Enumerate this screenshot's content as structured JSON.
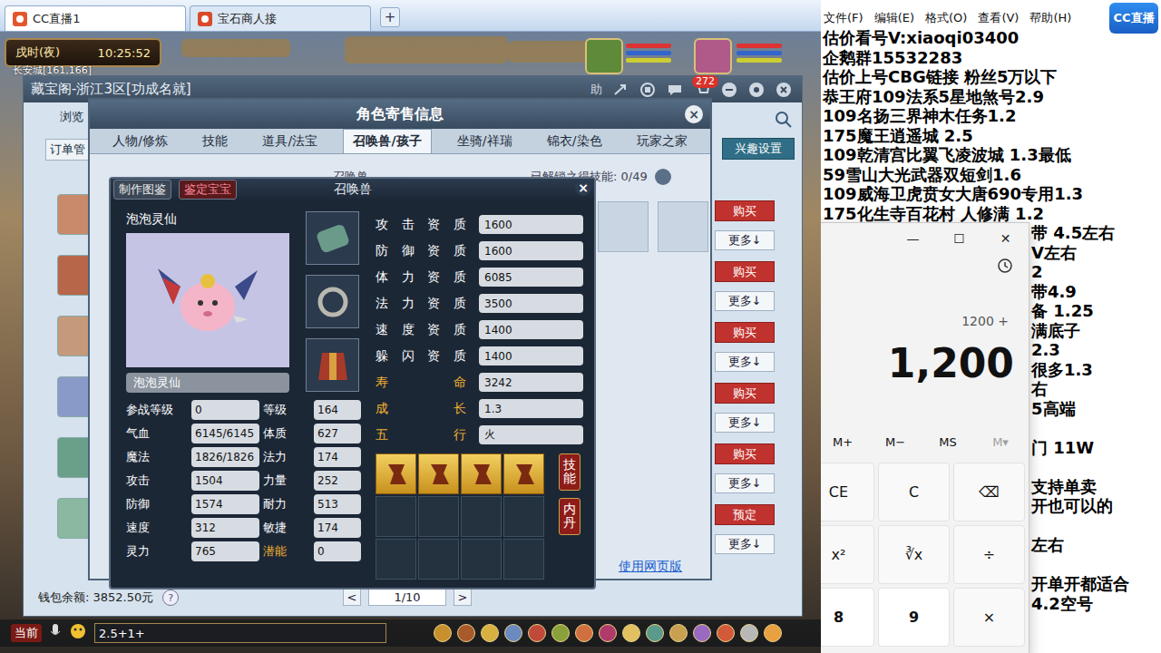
{
  "browser": {
    "tabs": [
      {
        "label": "CC直播1",
        "selected": true
      },
      {
        "label": "宝石商人接",
        "selected": false
      }
    ],
    "new_tab": "+"
  },
  "hud": {
    "period": "戌时(夜)",
    "clock": "10:25:52",
    "location": "长安城[161,166]"
  },
  "cbg": {
    "title": "藏宝阁-浙江3区[功成名就]",
    "help": "助",
    "badge": "272",
    "browse_tab": "浏览",
    "orders_button": "订单管",
    "interest_button": "兴趣设置",
    "rows": [
      {
        "action": "购买",
        "more": "更多↓"
      },
      {
        "action": "购买",
        "more": "更多↓"
      },
      {
        "action": "购买",
        "more": "更多↓"
      },
      {
        "action": "购买",
        "more": "更多↓"
      },
      {
        "action": "购买",
        "more": "更多↓"
      },
      {
        "action": "预定",
        "more": "更多↓"
      }
    ],
    "wallet": "钱包余额: 3852.50元",
    "wallet_help": "?",
    "prev": "<",
    "page": "1/10",
    "next": ">"
  },
  "sale": {
    "title": "角色寄售信息",
    "close": "×",
    "tabs": [
      {
        "label": "人物/修炼",
        "selected": false
      },
      {
        "label": "技能",
        "selected": false
      },
      {
        "label": "道具/法宝",
        "selected": false
      },
      {
        "label": "召唤兽/孩子",
        "selected": true
      },
      {
        "label": "坐骑/祥瑞",
        "selected": false
      },
      {
        "label": "锦衣/染色",
        "selected": false
      },
      {
        "label": "玩家之家",
        "selected": false
      }
    ],
    "section_label": "召唤兽",
    "unlocked": "已解锁之得技能: 0/49",
    "web_link": "使用网页版"
  },
  "pet": {
    "tool_buttons": [
      {
        "label": "制作图鉴"
      },
      {
        "label": "鉴定宝宝"
      }
    ],
    "title": "召唤兽",
    "close": "×",
    "name_label": "泡泡灵仙",
    "name_field": "泡泡灵仙",
    "stats": [
      {
        "left": {
          "label": "参战等级",
          "value": "0",
          "highlight": false
        },
        "right": {
          "label": "等级",
          "value": "164",
          "highlight": false
        }
      },
      {
        "left": {
          "label": "气血",
          "value": "6145/6145",
          "highlight": false
        },
        "right": {
          "label": "体质",
          "value": "627",
          "highlight": false
        }
      },
      {
        "left": {
          "label": "魔法",
          "value": "1826/1826",
          "highlight": false
        },
        "right": {
          "label": "法力",
          "value": "174",
          "highlight": false
        }
      },
      {
        "left": {
          "label": "攻击",
          "value": "1504",
          "highlight": false
        },
        "right": {
          "label": "力量",
          "value": "252",
          "highlight": false
        }
      },
      {
        "left": {
          "label": "防御",
          "value": "1574",
          "highlight": false
        },
        "right": {
          "label": "耐力",
          "value": "513",
          "highlight": false
        }
      },
      {
        "left": {
          "label": "速度",
          "value": "312",
          "highlight": false
        },
        "right": {
          "label": "敏捷",
          "value": "174",
          "highlight": false
        }
      },
      {
        "left": {
          "label": "灵力",
          "value": "765",
          "highlight": false
        },
        "right": {
          "label": "潜能",
          "value": "0",
          "highlight": true
        }
      }
    ],
    "qualities": [
      {
        "label": "攻击资质",
        "value": "1600",
        "highlight": false
      },
      {
        "label": "防御资质",
        "value": "1600",
        "highlight": false
      },
      {
        "label": "体力资质",
        "value": "6085",
        "highlight": false
      },
      {
        "label": "法力资质",
        "value": "3500",
        "highlight": false
      },
      {
        "label": "速度资质",
        "value": "1400",
        "highlight": false
      },
      {
        "label": "躲闪资质",
        "value": "1400",
        "highlight": false
      },
      {
        "label": "寿命",
        "value": "3242",
        "highlight": true
      },
      {
        "label": "成长",
        "value": "1.3",
        "highlight": true
      },
      {
        "label": "五行",
        "value": "火",
        "highlight": true
      }
    ],
    "skills": [
      {
        "filled": true
      },
      {
        "filled": true
      },
      {
        "filled": true
      },
      {
        "filled": true
      },
      {
        "filled": false
      },
      {
        "filled": false
      },
      {
        "filled": false
      },
      {
        "filled": false
      },
      {
        "filled": false
      },
      {
        "filled": false
      },
      {
        "filled": false
      },
      {
        "filled": false
      }
    ],
    "side_tabs": [
      {
        "label": "技能"
      },
      {
        "label": "内丹"
      }
    ]
  },
  "chat": {
    "channel": "当前",
    "input": "2.5+1+"
  },
  "notepad": {
    "menu": [
      "文件(F)",
      "编辑(E)",
      "格式(O)",
      "查看(V)",
      "帮助(H)"
    ],
    "lines": [
      {
        "text": "估价看号V:xiaoqi03400",
        "covered": false
      },
      {
        "text": "企鹅群15532283",
        "covered": false
      },
      {
        "text": "估价上号CBG链接 粉丝5万以下",
        "covered": false
      },
      {
        "text": "恭王府109法系5星地煞号2.9",
        "covered": false
      },
      {
        "text": "109名扬三界神木任务1.2",
        "covered": false
      },
      {
        "text": "175魔王逍遥城 2.5",
        "covered": false
      },
      {
        "text": "109乾清宫比翼飞凌波城 1.3最低",
        "covered": false
      },
      {
        "text": "59雪山大光武器双短剑1.6",
        "covered": false
      },
      {
        "text": "109威海卫虎贲女大唐690专用1.3",
        "covered": false
      },
      {
        "text": "175化生寺百花村 人修满 1.2",
        "covered": false
      },
      {
        "text": "带 4.5左右",
        "covered": true
      },
      {
        "text": "V左右",
        "covered": true
      },
      {
        "text": "2",
        "covered": true
      },
      {
        "text": "带4.9",
        "covered": true
      },
      {
        "text": "备 1.25",
        "covered": true
      },
      {
        "text": "满底子",
        "covered": true
      },
      {
        "text": "2.3",
        "covered": true
      },
      {
        "text": "很多1.3",
        "covered": true
      },
      {
        "text": "右",
        "covered": true
      },
      {
        "text": "5高端",
        "covered": true
      },
      {
        "text": "",
        "covered": true
      },
      {
        "text": "门 11W",
        "covered": true
      },
      {
        "text": "",
        "covered": true
      },
      {
        "text": "支持单卖",
        "covered": true
      },
      {
        "text": "开也可以的",
        "covered": true
      },
      {
        "text": "",
        "covered": true
      },
      {
        "text": "左右",
        "covered": true
      },
      {
        "text": "",
        "covered": true
      },
      {
        "text": "开单开都适合",
        "covered": true
      },
      {
        "text": "4.2空号",
        "covered": true
      }
    ]
  },
  "logo": "CC直播",
  "calculator": {
    "controls": [
      "—",
      "☐",
      "✕"
    ],
    "expression": "1200 +",
    "display": "1,200",
    "memory": [
      {
        "label": "M+",
        "disabled": false
      },
      {
        "label": "M−",
        "disabled": false
      },
      {
        "label": "MS",
        "disabled": false
      },
      {
        "label": "M▾",
        "disabled": true
      }
    ],
    "keys": [
      {
        "label": "CE",
        "kind": "op"
      },
      {
        "label": "C",
        "kind": "op"
      },
      {
        "label": "⌫",
        "kind": "op"
      },
      {
        "label": "x²",
        "kind": "op"
      },
      {
        "label": "∛x",
        "kind": "op"
      },
      {
        "label": "÷",
        "kind": "op"
      },
      {
        "label": "8",
        "kind": "digit"
      },
      {
        "label": "9",
        "kind": "digit"
      },
      {
        "label": "×",
        "kind": "op"
      }
    ]
  }
}
